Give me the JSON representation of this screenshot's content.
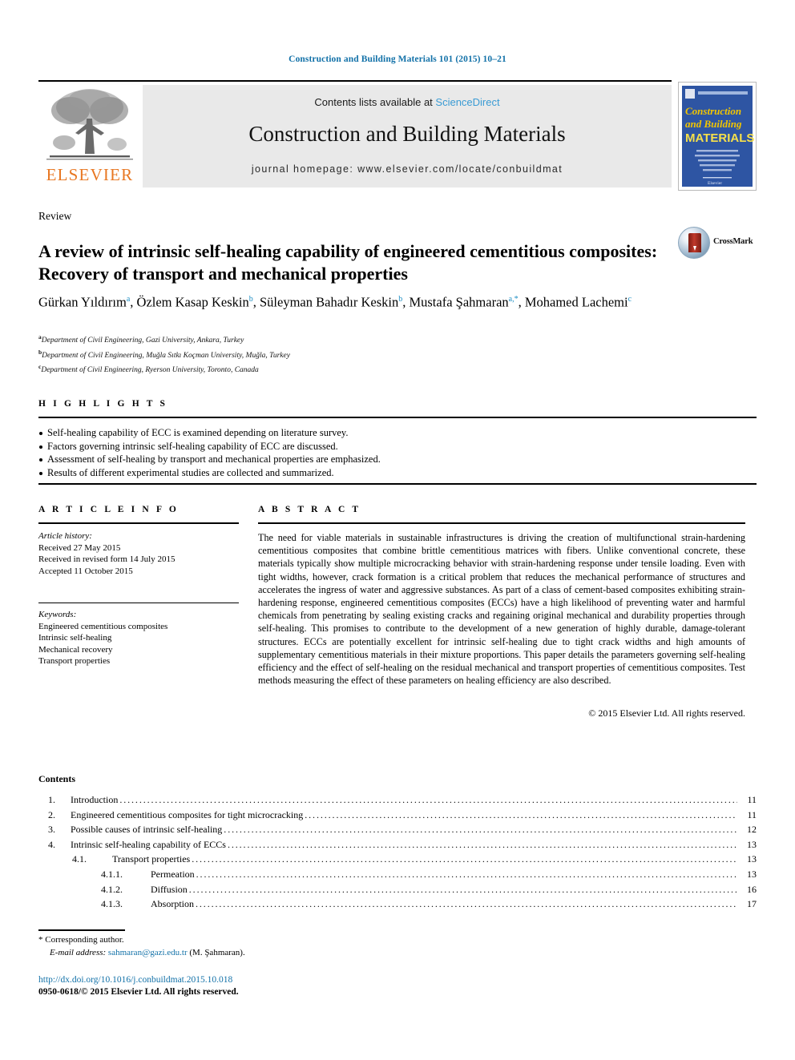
{
  "running_head": "Construction and Building Materials 101 (2015) 10–21",
  "masthead": {
    "contents_prefix": "Contents lists available at ",
    "sciencedirect": "ScienceDirect",
    "journal_title": "Construction and Building Materials",
    "homepage": "journal homepage: www.elsevier.com/locate/conbuildmat",
    "publisher_name": "ELSEVIER",
    "cover": {
      "line1": "Construction",
      "line2": "and Building",
      "line3": "MATERIALS",
      "blurb": "An International Journal Dedicated to the Investigation and Innovative Use of Materials in Construction and Repair",
      "footer": "Elsevier"
    },
    "accent_link_color": "#3a9bd4",
    "box_bg": "#e9e9e9",
    "elsevier_orange": "#e87722"
  },
  "article": {
    "type": "Review",
    "title": "A review of intrinsic self-healing capability of engineered cementitious composites: Recovery of transport and mechanical properties",
    "crossmark_label": "CrossMark",
    "authors": [
      {
        "name": "Gürkan Yıldırım",
        "sup": "a",
        "sep": ", "
      },
      {
        "name": "Özlem Kasap Keskin",
        "sup": "b",
        "sep": ", "
      },
      {
        "name": "Süleyman Bahadır Keskin",
        "sup": "b",
        "sep": ", "
      },
      {
        "name": "Mustafa Şahmaran",
        "sup": "a,*",
        "sep": ", "
      },
      {
        "name": "Mohamed Lachemi",
        "sup": "c",
        "sep": ""
      }
    ],
    "affiliations": [
      {
        "marker": "a",
        "text": "Department of Civil Engineering, Gazi University, Ankara, Turkey"
      },
      {
        "marker": "b",
        "text": "Department of Civil Engineering, Muğla Sıtkı Koçman University, Muğla, Turkey"
      },
      {
        "marker": "c",
        "text": "Department of Civil Engineering, Ryerson University, Toronto, Canada"
      }
    ]
  },
  "highlights": {
    "heading": "H I G H L I G H T S",
    "items": [
      "Self-healing capability of ECC is examined depending on literature survey.",
      "Factors governing intrinsic self-healing capability of ECC are discussed.",
      "Assessment of self-healing by transport and mechanical properties are emphasized.",
      "Results of different experimental studies are collected and summarized."
    ]
  },
  "article_info": {
    "heading": "A R T I C L E   I N F O",
    "history_label": "Article history:",
    "history": [
      "Received 27 May 2015",
      "Received in revised form 14 July 2015",
      "Accepted 11 October 2015"
    ],
    "keywords_label": "Keywords:",
    "keywords": [
      "Engineered cementitious composites",
      "Intrinsic self-healing",
      "Mechanical recovery",
      "Transport properties"
    ]
  },
  "abstract": {
    "heading": "A B S T R A C T",
    "body": "The need for viable materials in sustainable infrastructures is driving the creation of multifunctional strain-hardening cementitious composites that combine brittle cementitious matrices with fibers. Unlike conventional concrete, these materials typically show multiple microcracking behavior with strain-hardening response under tensile loading. Even with tight widths, however, crack formation is a critical problem that reduces the mechanical performance of structures and accelerates the ingress of water and aggressive substances. As part of a class of cement-based composites exhibiting strain-hardening response, engineered cementitious composites (ECCs) have a high likelihood of preventing water and harmful chemicals from penetrating by sealing existing cracks and regaining original mechanical and durability properties through self-healing. This promises to contribute to the development of a new generation of highly durable, damage-tolerant structures. ECCs are potentially excellent for intrinsic self-healing due to tight crack widths and high amounts of supplementary cementitious materials in their mixture proportions. This paper details the parameters governing self-healing efficiency and the effect of self-healing on the residual mechanical and transport properties of cementitious composites. Test methods measuring the effect of these parameters on healing efficiency are also described.",
    "copyright": "© 2015 Elsevier Ltd. All rights reserved."
  },
  "contents": {
    "label": "Contents",
    "entries": [
      {
        "level": 1,
        "num": "1.",
        "label": "Introduction",
        "page": "11"
      },
      {
        "level": 1,
        "num": "2.",
        "label": "Engineered cementitious composites for tight microcracking",
        "page": "11"
      },
      {
        "level": 1,
        "num": "3.",
        "label": "Possible causes of intrinsic self-healing",
        "page": "12"
      },
      {
        "level": 1,
        "num": "4.",
        "label": "Intrinsic self-healing capability of ECCs",
        "page": "13"
      },
      {
        "level": 2,
        "num": "4.1.",
        "label": "Transport properties",
        "page": "13"
      },
      {
        "level": 3,
        "num": "4.1.1.",
        "label": "Permeation",
        "page": "13"
      },
      {
        "level": 3,
        "num": "4.1.2.",
        "label": "Diffusion",
        "page": "16"
      },
      {
        "level": 3,
        "num": "4.1.3.",
        "label": "Absorption",
        "page": "17"
      }
    ]
  },
  "footer": {
    "corresponding_marker": "*",
    "corresponding_text": "Corresponding author.",
    "email_label": "E-mail address:",
    "email": "sahmaran@gazi.edu.tr",
    "email_owner": "(M. Şahmaran).",
    "doi": "http://dx.doi.org/10.1016/j.conbuildmat.2015.10.018",
    "issn": "0950-0618/© 2015 Elsevier Ltd. All rights reserved.",
    "link_color": "#1271a8"
  }
}
